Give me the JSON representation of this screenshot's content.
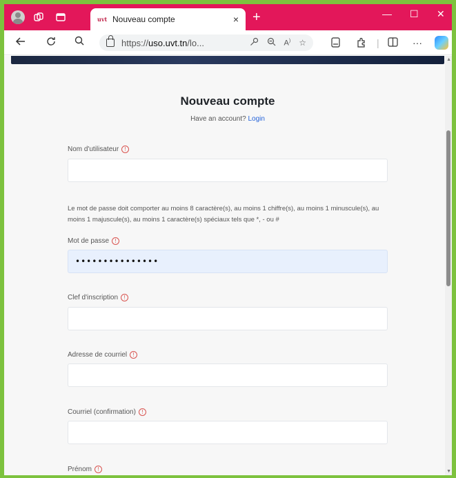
{
  "browser": {
    "tab_title": "Nouveau compte",
    "tab_favicon_text": "uvt",
    "url_prefix": "https://",
    "url_host": "uso.uvt.tn",
    "url_suffix": "/lo...",
    "tab_close": "×",
    "new_tab": "+",
    "controls": {
      "minimize": "—",
      "maximize": "☐",
      "close": "✕"
    },
    "more_menu": "···"
  },
  "form": {
    "heading": "Nouveau compte",
    "have_account_text": "Have an account?",
    "login_link": "Login",
    "password_hint": "Le mot de passe doit comporter au moins 8 caractère(s), au moins 1 chiffre(s), au moins 1 minuscule(s), au moins 1 majuscule(s), au moins 1 caractère(s) spéciaux tels que *, - ou #",
    "info_glyph": "!",
    "fields": {
      "username": {
        "label": "Nom d'utilisateur",
        "value": ""
      },
      "password": {
        "label": "Mot de passe",
        "value": "•••••••••••••••"
      },
      "registration_key": {
        "label": "Clef d'inscription",
        "value": ""
      },
      "email": {
        "label": "Adresse de courriel",
        "value": ""
      },
      "email_confirm": {
        "label": "Courriel (confirmation)",
        "value": ""
      },
      "firstname": {
        "label": "Prénom",
        "value": ""
      }
    }
  }
}
